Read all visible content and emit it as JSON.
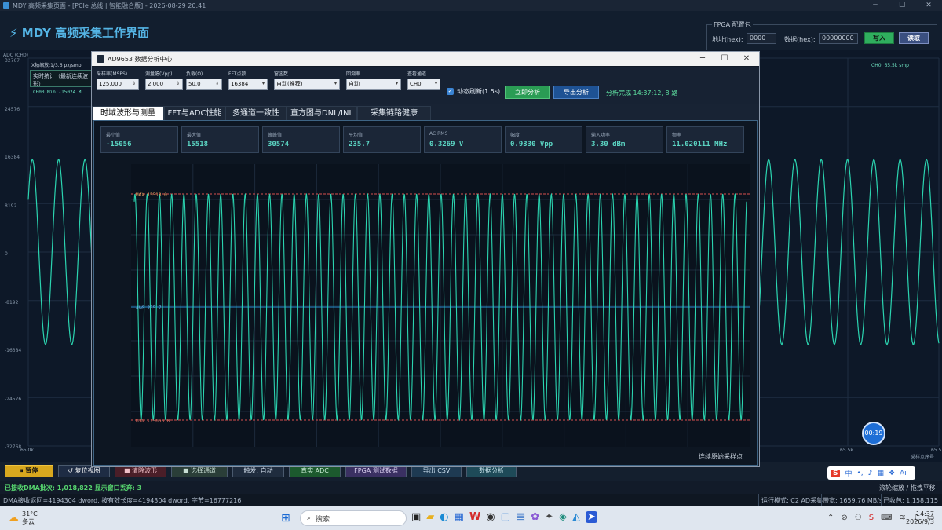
{
  "app": {
    "window_title": "MDY 高频采集页面 - [PCIe 总线 | 智能融合版] - 2026-08-29 20:41",
    "header_title": "MDY 高频采集工作界面",
    "fpga": {
      "legend": "FPGA 配置包",
      "addr_label": "地址(hex):",
      "addr_value": "0000",
      "data_label": "数据(hex):",
      "data_value": "00000000",
      "write_label": "写入",
      "read_label": "读取"
    }
  },
  "bg_plot": {
    "y_axis_title": "ADC (CH0)",
    "y_ticks": [
      "32767",
      "24576",
      "16384",
      "8192",
      "0",
      "-8192",
      "-16384",
      "-24576",
      "-32768"
    ],
    "zoom_label": "X轴缩放:1/3.6 px/smp",
    "stats_title": "实时统计（最新连续波形）",
    "stats_line": "CH00  Min:-15024  M",
    "right_label": "CH0: 65.5k smp",
    "x_left": "65.0k",
    "x_mid": "65.5k",
    "x_right": "65.5",
    "x_title": "采样点序号"
  },
  "toolbar": {
    "pause": "⏸ 暂停",
    "reset": "↺ 复位视图",
    "clear": "■ 清除波形",
    "select": "■ 选择通道",
    "trigger": "触发: 自动",
    "real_adc": "真实 ADC",
    "fpga_test": "FPGA 测试数据",
    "export_csv": "导出 CSV",
    "data_analysis": "数据分析"
  },
  "status": {
    "dma_count": "已接收DMA批次: 1,018,822  显示窗口丢弃: 3",
    "dma_info": "DMA接收返回=4194304 dword, 按有效长度=4194304 dword, 字节=16777216",
    "run_mode": "运行模式: C2 AD采集",
    "bandwidth": "带宽: 1659.76 MB/s",
    "received": "已收包: 1,158,115",
    "hint": "滚轮缩放 / 拖拽平移",
    "timer": "00:19"
  },
  "ime": {
    "brand": "S",
    "lang": "中",
    "ai": "Ai"
  },
  "dialog": {
    "title": "AD9653 数据分析中心",
    "params": [
      {
        "label": "采样率(MSPS)",
        "value": "125.000",
        "spin": true
      },
      {
        "label": "测量幅(Vpp)",
        "value": "2.000",
        "spin": true
      },
      {
        "label": "负载(Ω)",
        "value": "50.0",
        "spin": true
      },
      {
        "label": "FFT点数",
        "value": "16384",
        "spin": false
      },
      {
        "label": "窗函数",
        "value": "自动(推荐)",
        "spin": false
      },
      {
        "label": "回溯率",
        "value": "自动",
        "spin": false
      },
      {
        "label": "查看通道",
        "value": "CH0",
        "spin": false
      }
    ],
    "auto_refresh": "动态刷新(1.5s)",
    "analyze_now": "立即分析",
    "export_analysis": "导出分析",
    "analysis_status": "分析完成 14:37:12, 8 路",
    "tabs": [
      "时域波形与测量",
      "FFT与ADC性能",
      "多通道一致性",
      "直方图与DNL/INL",
      "采集链路健康"
    ],
    "cards": [
      {
        "label": "最小值",
        "value": "-15056"
      },
      {
        "label": "最大值",
        "value": "15518"
      },
      {
        "label": "峰峰值",
        "value": "30574"
      },
      {
        "label": "平均值",
        "value": "235.7"
      },
      {
        "label": "AC RMS",
        "value": "0.3269 V"
      },
      {
        "label": "幅度",
        "value": "0.9330 Vpp"
      },
      {
        "label": "输入功率",
        "value": "3.30 dBm"
      },
      {
        "label": "频率",
        "value": "11.020111 MHz"
      }
    ],
    "max_label": "MAX 15518.0",
    "avg_label": "AVG 235.7",
    "min_label": "MIN -15056.0",
    "footer": "连续原始采样点"
  },
  "taskbar": {
    "temp": "31°C",
    "weather": "多云",
    "search": "搜索",
    "time": "14:37",
    "date": "2026/9/3"
  },
  "colors": {
    "wave": "#2bd4b0",
    "accent": "#54b4e4",
    "max_line": "#d85050",
    "avg_line": "#2a8fd4"
  }
}
